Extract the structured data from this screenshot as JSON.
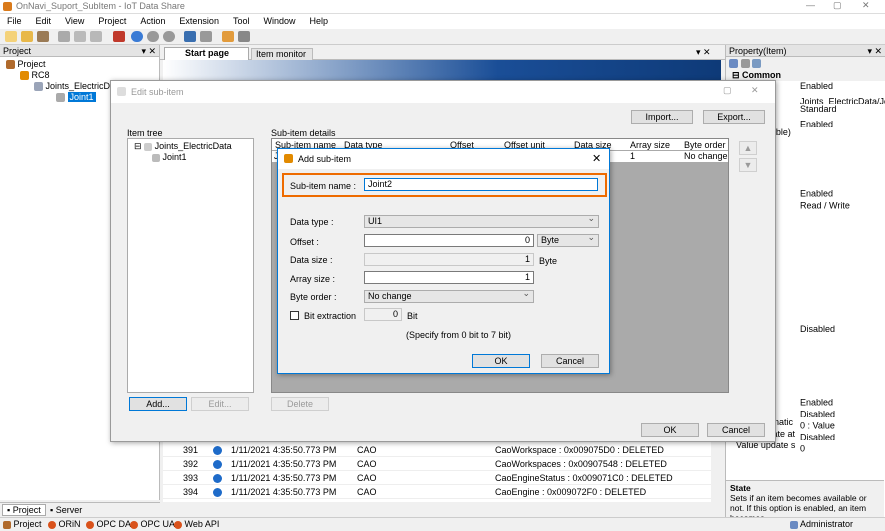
{
  "window": {
    "title": "OnNavi_Suport_SubItem - IoT Data Share"
  },
  "menu": [
    "File",
    "Edit",
    "View",
    "Project",
    "Action",
    "Extension",
    "Tool",
    "Window",
    "Help"
  ],
  "project_panel": {
    "title": "Project",
    "pin": "▾ ✕",
    "tree": [
      "Project",
      "RC8",
      "Joints_ElectricD",
      "Joint1"
    ]
  },
  "tabs": {
    "start": "Start page",
    "monitor": "Item monitor"
  },
  "property_panel": {
    "title": "Property(Item)",
    "section_common": "Common",
    "section_state": "State",
    "rows": [
      [
        "",
        "Enabled"
      ],
      [
        "ame",
        "Joints_ElectricData/Jo"
      ],
      [
        "",
        "Standard"
      ],
      [
        "ode",
        "Enabled"
      ],
      [
        "(CaoVariable)",
        ""
      ],
      [
        "name",
        ""
      ],
      [
        "",
        ""
      ],
      [
        "bject",
        ""
      ],
      [
        "",
        ""
      ],
      [
        "g targ",
        "Enabled"
      ],
      [
        "ng targ",
        "Read / Write"
      ],
      [
        "tinatic",
        ""
      ],
      [
        "ttings",
        ""
      ],
      [
        "n",
        ""
      ],
      [
        "settin",
        ""
      ],
      [
        "ings",
        ""
      ],
      [
        "er",
        ""
      ],
      [
        "n ban",
        ""
      ],
      [
        "ging che",
        ""
      ],
      [
        "nversion",
        ""
      ],
      [
        "",
        ""
      ],
      [
        "",
        "Disabled"
      ],
      [
        "eration",
        ""
      ],
      [
        "nversic",
        ""
      ],
      [
        "nversic",
        ""
      ],
      [
        "",
        ""
      ],
      [
        "",
        ""
      ],
      [
        "ment",
        "Enabled"
      ],
      [
        "ement",
        "Disabled"
      ],
      [
        "Link destinatic",
        "0 : Value"
      ],
      [
        "Data update at",
        "Disabled"
      ],
      [
        "Value update s",
        "0"
      ]
    ],
    "description": "Sets if an item becomes available or not. If this option is enabled, an item becomes"
  },
  "edit_dialog": {
    "title": "Edit sub-item",
    "import": "Import...",
    "export": "Export...",
    "item_tree_label": "Item tree",
    "tree": [
      "Joints_ElectricData",
      "Joint1"
    ],
    "details_label": "Sub-item details",
    "columns": [
      "Sub-item name",
      "Data type",
      "Offset",
      "Offset unit",
      "Data size",
      "Array size",
      "Byte order"
    ],
    "row": {
      "name": "Jo",
      "array": "1",
      "order": "No change"
    },
    "add": "Add...",
    "edit": "Edit...",
    "delete": "Delete",
    "ok": "OK",
    "cancel": "Cancel"
  },
  "add_dialog": {
    "title": "Add sub-item",
    "name_label": "Sub-item name :",
    "name_value": "Joint2",
    "data_type_label": "Data type :",
    "data_type_value": "UI1",
    "offset_label": "Offset :",
    "offset_value": "0",
    "offset_unit": "Byte",
    "data_size_label": "Data size :",
    "data_size_value": "1",
    "data_size_unit": "Byte",
    "array_size_label": "Array size :",
    "array_size_value": "1",
    "byte_order_label": "Byte order :",
    "byte_order_value": "No change",
    "bit_label": "Bit extraction",
    "bit_value": "0",
    "bit_unit": "Bit",
    "hint": "(Specify from 0 bit to 7 bit)",
    "ok": "OK",
    "cancel": "Cancel"
  },
  "log": [
    {
      "id": "391",
      "time": "1/11/2021 4:35:50.773 PM",
      "src": "CAO",
      "msg": "CaoWorkspace : 0x009075D0 : DELETED"
    },
    {
      "id": "392",
      "time": "1/11/2021 4:35:50.773 PM",
      "src": "CAO",
      "msg": "CaoWorkspaces : 0x00907548 : DELETED"
    },
    {
      "id": "393",
      "time": "1/11/2021 4:35:50.773 PM",
      "src": "CAO",
      "msg": "CaoEngineStatus : 0x009071C0 : DELETED"
    },
    {
      "id": "394",
      "time": "1/11/2021 4:35:50.773 PM",
      "src": "CAO",
      "msg": "CaoEngine : 0x009072F0 : DELETED"
    }
  ],
  "bottom_tabs": {
    "project": "Project",
    "server": "Server"
  },
  "statusbar": {
    "items": [
      "Project",
      "ORiN",
      "OPC DA",
      "OPC UA",
      "Web API"
    ],
    "user": "Administrator"
  },
  "colors": {
    "highlight": "#ee6b00",
    "accent": "#0078d7"
  }
}
